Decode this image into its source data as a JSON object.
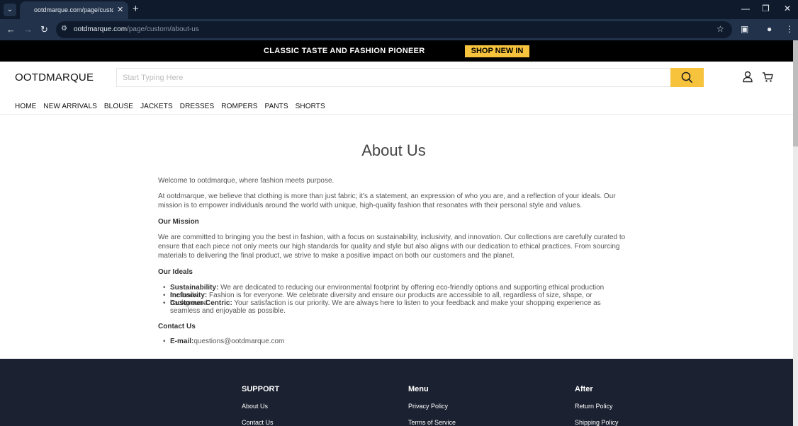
{
  "browser": {
    "tab_title": "ootdmarque.com/page/custom/",
    "url_host": "ootdmarque.com",
    "url_path": "/page/custom/about-us"
  },
  "promo": {
    "text": "CLASSIC TASTE AND FASHION PIONEER",
    "button": "SHOP NEW IN"
  },
  "header": {
    "logo": "OOTDMARQUE",
    "search_placeholder": "Start Typing Here"
  },
  "nav": [
    "HOME",
    "NEW ARRIVALS",
    "BLOUSE",
    "JACKETS",
    "DRESSES",
    "ROMPERS",
    "PANTS",
    "SHORTS"
  ],
  "content": {
    "title": "About Us",
    "intro": "Welcome to ootdmarque, where fashion meets purpose.",
    "belief": "At ootdmarque, we believe that clothing is more than just fabric; it's a statement, an expression of who you are, and a reflection of your ideals. Our mission is to empower individuals around the world with unique, high-quality fashion that resonates with their personal style and values.",
    "mission_heading": "Our Mission",
    "mission_text": "We are committed to bringing you the best in fashion, with a focus on sustainability, inclusivity, and innovation. Our collections are carefully curated to ensure that each piece not only meets our high standards for quality and style but also aligns with our dedication to ethical practices. From sourcing materials to delivering the final product, we strive to make a positive impact on both our customers and the planet.",
    "ideals_heading": "Our Ideals",
    "ideals": [
      {
        "label": "Sustainability:",
        "text": " We are dedicated to reducing our environmental footprint by offering eco-friendly options and supporting ethical production methods."
      },
      {
        "label": "Inclusivity:",
        "text": " Fashion is for everyone. We celebrate diversity and ensure our products are accessible to all, regardless of size, shape, or background."
      },
      {
        "label": "Customer-Centric:",
        "text": " Your satisfaction is our priority. We are always here to listen to your feedback and make your shopping experience as seamless and enjoyable as possible."
      }
    ],
    "contact_heading": "Contact Us",
    "email_label": "E-mail:",
    "email": "questions@ootdmarque.com"
  },
  "footer": {
    "support": {
      "heading": "SUPPORT",
      "links": [
        "About Us",
        "Contact Us"
      ]
    },
    "menu": {
      "heading": "Menu",
      "links": [
        "Privacy Policy",
        "Terms of Service"
      ]
    },
    "after": {
      "heading": "After",
      "links": [
        "Return Policy",
        "Shipping Policy"
      ]
    }
  }
}
